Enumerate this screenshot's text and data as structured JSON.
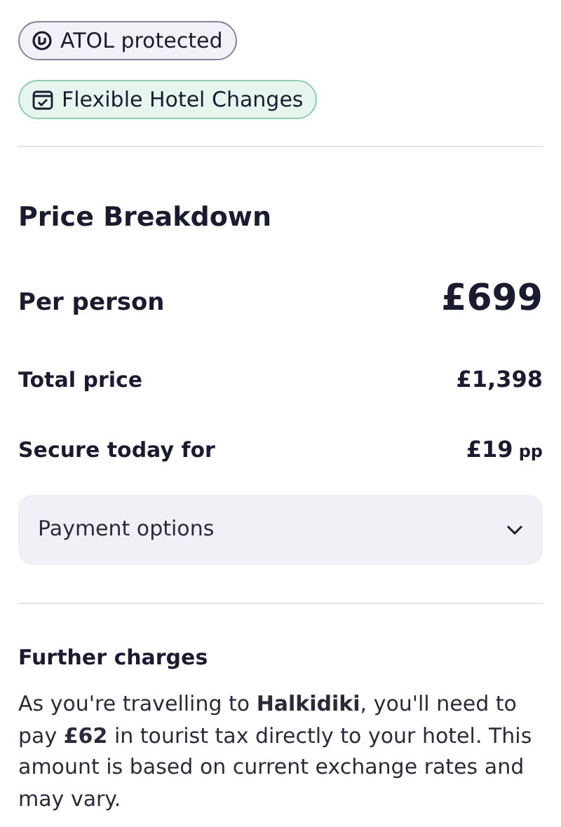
{
  "badges": [
    {
      "kind": "atol",
      "label": "ATOL protected"
    },
    {
      "kind": "flexible",
      "label": "Flexible Hotel Changes"
    }
  ],
  "price_breakdown": {
    "title": "Price Breakdown",
    "rows": [
      {
        "kind": "main",
        "label": "Per person",
        "value": "£699"
      },
      {
        "kind": "normal",
        "label": "Total price",
        "value": "£1,398"
      },
      {
        "kind": "normal",
        "label": "Secure today for",
        "value": "£19",
        "suffix": "pp"
      }
    ],
    "payment_options": {
      "label": "Payment options",
      "expanded": false
    }
  },
  "further_charges": {
    "title": "Further charges",
    "text": "As you're travelling to **Halkidiki**, you'll need to pay **£62** in tourist tax directly to your hotel. This amount is based on current exchange rates and may vary."
  }
}
